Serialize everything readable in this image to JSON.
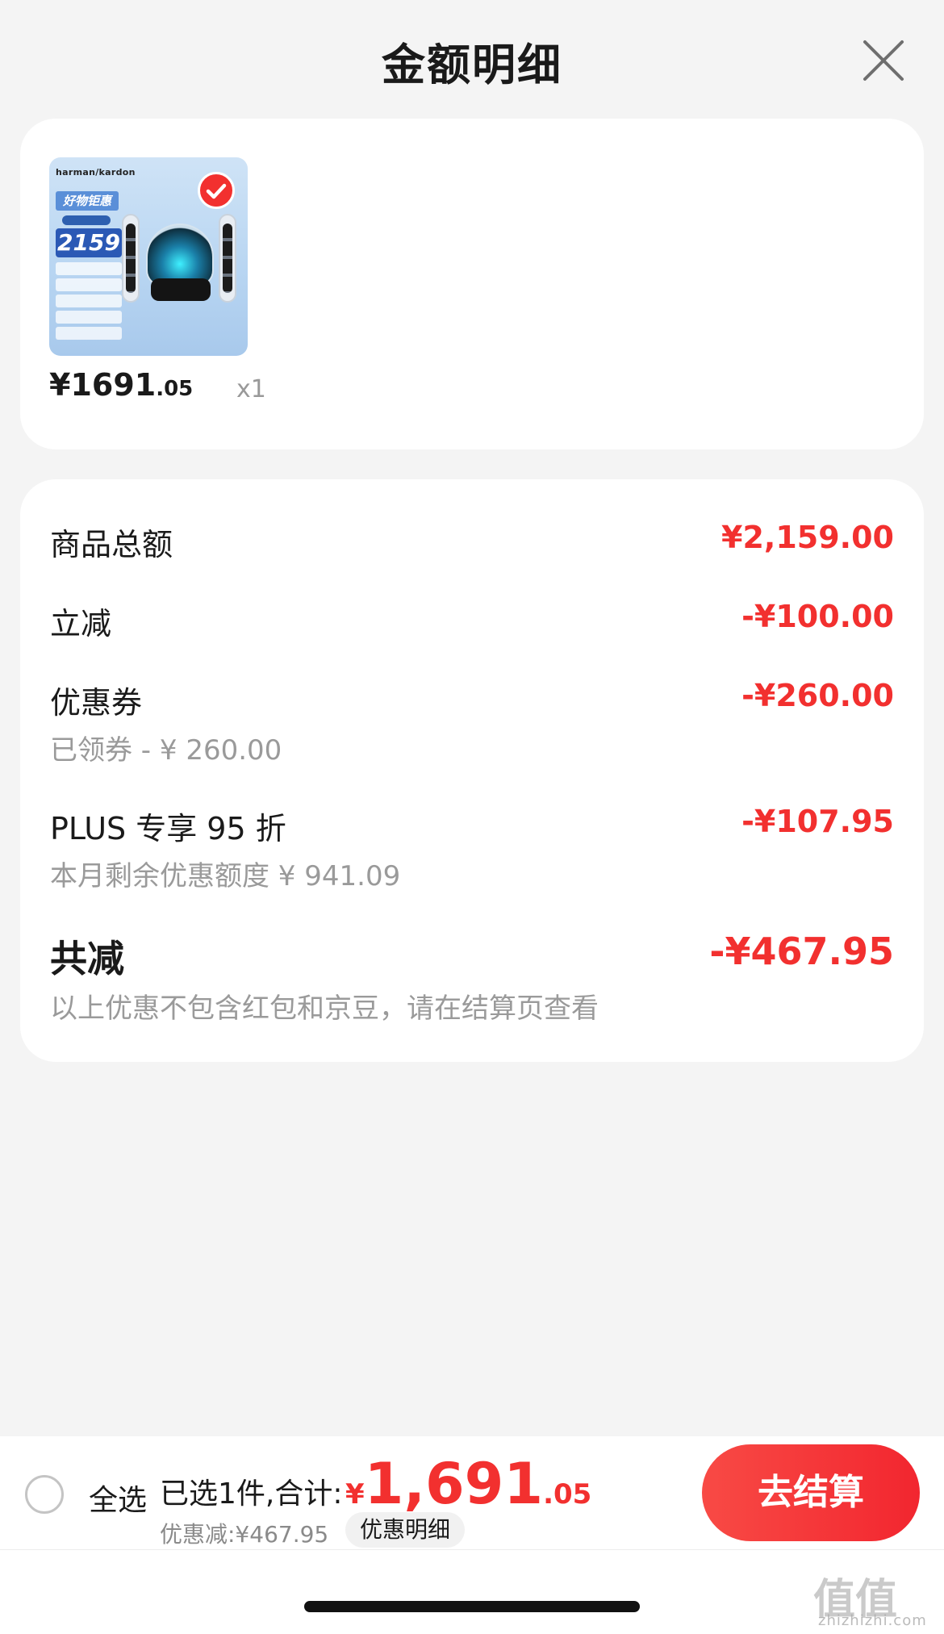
{
  "header": {
    "title": "金额明细",
    "close_icon": "close-icon"
  },
  "product": {
    "brand": "harman/kardon",
    "thumb_tag": "好物钜惠",
    "thumb_price": "2159",
    "price_int": "¥1691",
    "price_dec": ".05",
    "quantity": "x1",
    "selected": true
  },
  "details": {
    "goods_total_label": "商品总额",
    "goods_total_value": "¥2,159.00",
    "instant_label": "立减",
    "instant_value": "-¥100.00",
    "coupon_label": "优惠券",
    "coupon_value": "-¥260.00",
    "coupon_sub": "已领券 - ¥ 260.00",
    "plus_label": "PLUS 专享 95 折",
    "plus_value": "-¥107.95",
    "plus_sub": "本月剩余优惠额度 ¥ 941.09",
    "total_label": "共减",
    "total_value": "-¥467.95",
    "note": "以上优惠不包含红包和京豆，请在结算页查看"
  },
  "bottom_bar": {
    "select_all_label": "全选",
    "selected_text": "已选1件,合计:",
    "total_currency": "¥",
    "total_int": "1,691",
    "total_dec": ".05",
    "discount_text": "优惠减:¥467.95",
    "detail_chip": "优惠明细",
    "checkout_label": "去结算"
  },
  "watermark": {
    "glyphs": "值值值",
    "text": "zhizhizhi.com"
  },
  "colors": {
    "accent": "#f2302f",
    "muted": "#9a9a9a",
    "background": "#f4f4f4"
  }
}
